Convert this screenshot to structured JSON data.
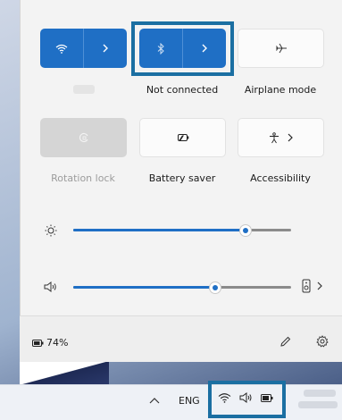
{
  "quick_settings": {
    "wifi": {
      "label": "",
      "state": "on",
      "icon": "wifi-icon",
      "expand_icon": "chevron-right-icon"
    },
    "bluetooth": {
      "label": "Not connected",
      "state": "on",
      "icon": "bluetooth-icon",
      "expand_icon": "chevron-right-icon"
    },
    "airplane": {
      "label": "Airplane mode",
      "state": "off",
      "icon": "airplane-icon"
    },
    "rotation_lock": {
      "label": "Rotation lock",
      "state": "disabled",
      "icon": "rotation-lock-icon"
    },
    "battery_saver": {
      "label": "Battery saver",
      "state": "off",
      "icon": "battery-saver-icon"
    },
    "accessibility": {
      "label": "Accessibility",
      "state": "off",
      "icon": "accessibility-icon",
      "expand_icon": "chevron-right-icon"
    }
  },
  "sliders": {
    "brightness": {
      "icon": "brightness-icon",
      "value": 0.79
    },
    "volume": {
      "icon": "speaker-icon",
      "value": 0.65,
      "device_icon": "audio-device-icon",
      "expand_icon": "chevron-right-icon"
    }
  },
  "footer": {
    "battery_text": "74%",
    "battery_icon": "battery-icon",
    "edit_icon": "pencil-icon",
    "settings_icon": "gear-icon"
  },
  "taskbar": {
    "overflow_icon": "chevron-up-icon",
    "language": "ENG",
    "tray_icons": [
      "wifi-icon",
      "speaker-icon",
      "battery-icon"
    ]
  },
  "colors": {
    "accent": "#1f6fc5",
    "highlight_box": "#1b6fa2"
  }
}
